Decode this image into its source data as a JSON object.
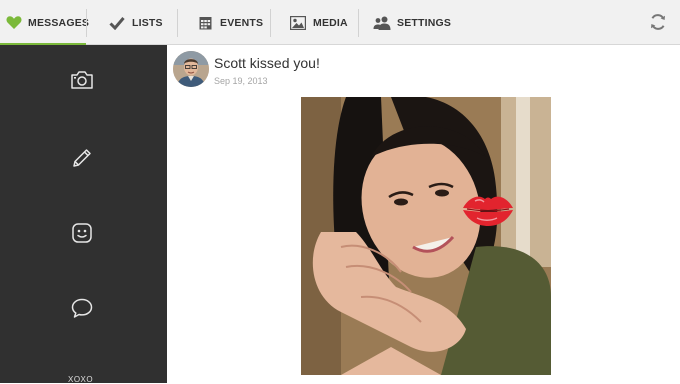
{
  "tabs": [
    {
      "label": "MESSAGES",
      "icon": "heart-icon",
      "active": true
    },
    {
      "label": "LISTS",
      "icon": "checkmark-icon",
      "active": false
    },
    {
      "label": "EVENTS",
      "icon": "calendar-icon",
      "active": false
    },
    {
      "label": "MEDIA",
      "icon": "picture-icon",
      "active": false
    },
    {
      "label": "SETTINGS",
      "icon": "people-icon",
      "active": false
    }
  ],
  "refresh_icon": "refresh-icon",
  "sidebar": {
    "items": [
      "camera-icon",
      "pencil-icon",
      "smiley-icon",
      "chat-bubble-icon"
    ],
    "bottom_label": "XOXO"
  },
  "message": {
    "title": "Scott kissed you!",
    "date": "Sep 19, 2013"
  },
  "colors": {
    "accent": "#7bb93a",
    "sidebar": "#303030",
    "topbar": "#f1f1f1",
    "kiss": "#e2242e"
  }
}
